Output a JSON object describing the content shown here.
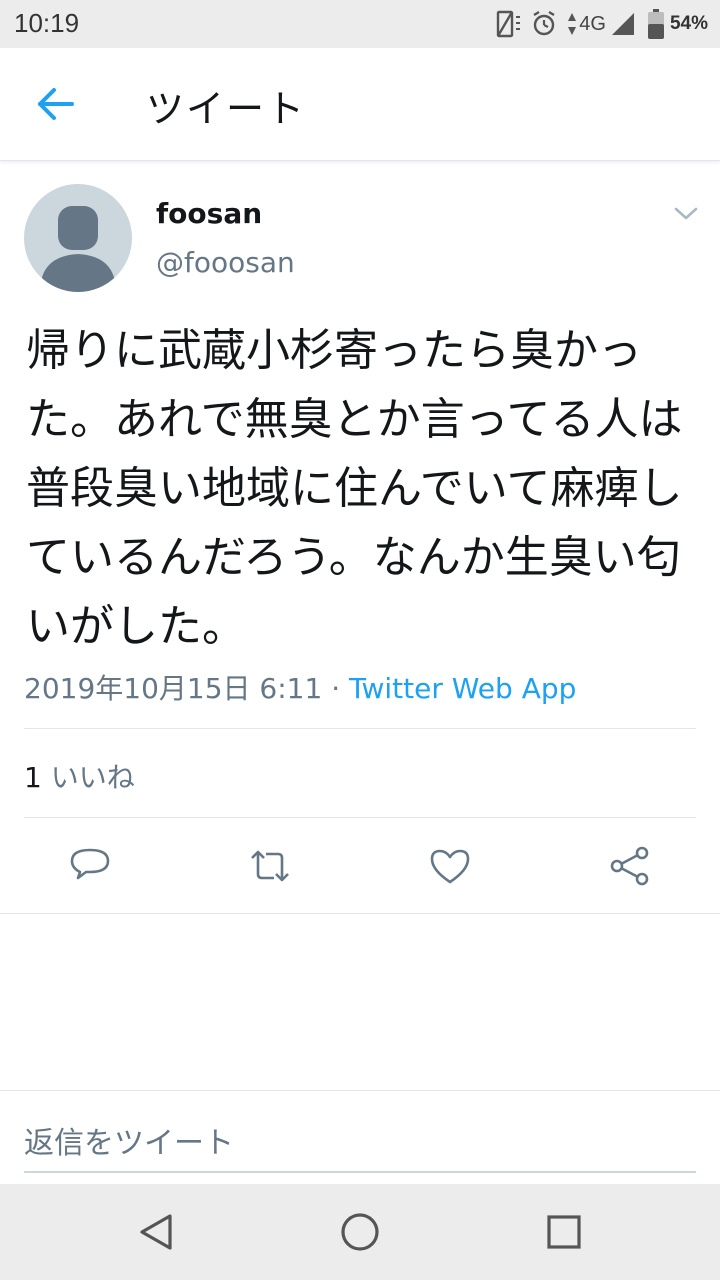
{
  "status_bar": {
    "time": "10:19",
    "network": "4G",
    "battery": "54%",
    "icons": [
      "vibrate-icon",
      "alarm-icon",
      "signal-icon",
      "battery-icon"
    ]
  },
  "header": {
    "title": "ツイート",
    "back_icon": "back-arrow-icon"
  },
  "tweet": {
    "display_name": "foosan",
    "handle": "@fooosan",
    "text": "帰りに武蔵小杉寄ったら臭かった。あれで無臭とか言ってる人は普段臭い地域に住んでいて麻痺しているんだろう。なんか生臭い匂いがした。",
    "timestamp": "2019年10月15日 6:11",
    "separator": "·",
    "source": "Twitter Web App",
    "likes_count": "1",
    "likes_label": "いいね",
    "actions": [
      "reply-icon",
      "retweet-icon",
      "like-icon",
      "share-icon"
    ]
  },
  "reply": {
    "placeholder": "返信をツイート"
  },
  "nav": {
    "buttons": [
      "back-triangle-icon",
      "home-circle-icon",
      "recents-square-icon"
    ]
  },
  "colors": {
    "accent": "#1da1f2",
    "secondary_text": "#657786",
    "divider": "#e1e8ed"
  }
}
